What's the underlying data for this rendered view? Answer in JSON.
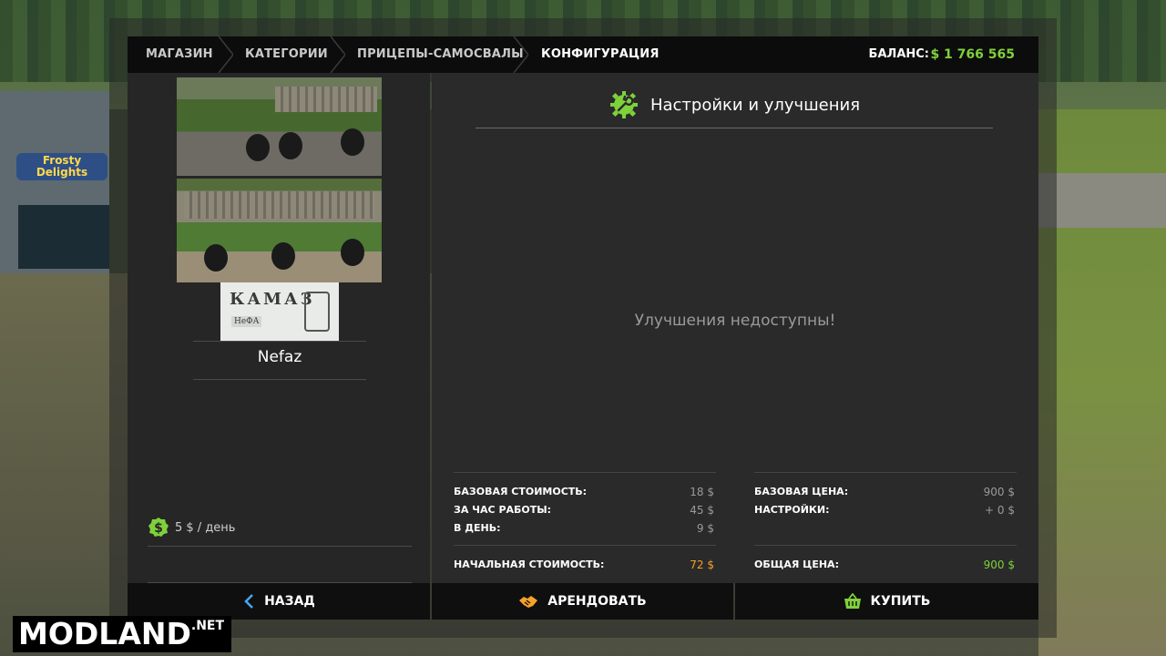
{
  "breadcrumb": {
    "items": [
      "МАГАЗИН",
      "КАТЕГОРИИ",
      "ПРИЦЕПЫ-САМОСВАЛЫ",
      "КОНФИГУРАЦИЯ"
    ],
    "active_index": 3
  },
  "balance": {
    "label": "БАЛАНС:",
    "value": "$ 1 766 565"
  },
  "vehicle": {
    "name": "Nefaz",
    "brand_logo_text": "КАМАЗ",
    "brand_logo_small": "НеФА",
    "rent_text": "5 $ / день"
  },
  "config": {
    "title": "Настройки и улучшения",
    "empty_message": "Улучшения недоступны!"
  },
  "costs": {
    "left": [
      {
        "label": "БАЗОВАЯ СТОИМОСТЬ:",
        "value": "18 $"
      },
      {
        "label": "ЗА ЧАС РАБОТЫ:",
        "value": "45 $"
      },
      {
        "label": "В ДЕНЬ:",
        "value": "9 $"
      }
    ],
    "left_total": {
      "label": "НАЧАЛЬНАЯ СТОИМОСТЬ:",
      "value": "72 $"
    },
    "right": [
      {
        "label": "БАЗОВАЯ ЦЕНА:",
        "value": "900 $"
      },
      {
        "label": "НАСТРОЙКИ:",
        "value": "+ 0 $"
      }
    ],
    "right_total": {
      "label": "ОБЩАЯ ЦЕНА:",
      "value": "900 $"
    }
  },
  "buttons": {
    "back": "НАЗАД",
    "lease": "АРЕНДОВАТЬ",
    "buy": "КУПИТЬ"
  },
  "background": {
    "shop_sign": "Frosty Delights"
  },
  "watermark": {
    "text": "MODLAND",
    "suffix": ".NET"
  },
  "colors": {
    "accent_green": "#7fd13b",
    "accent_orange": "#f4a22a",
    "panel_dark": "#0c0c0c"
  },
  "icons": {
    "settings": "wrench-gear-icon",
    "rent": "dollar-coin-icon",
    "back": "chevron-left-icon",
    "lease": "handshake-icon",
    "buy": "basket-icon"
  }
}
